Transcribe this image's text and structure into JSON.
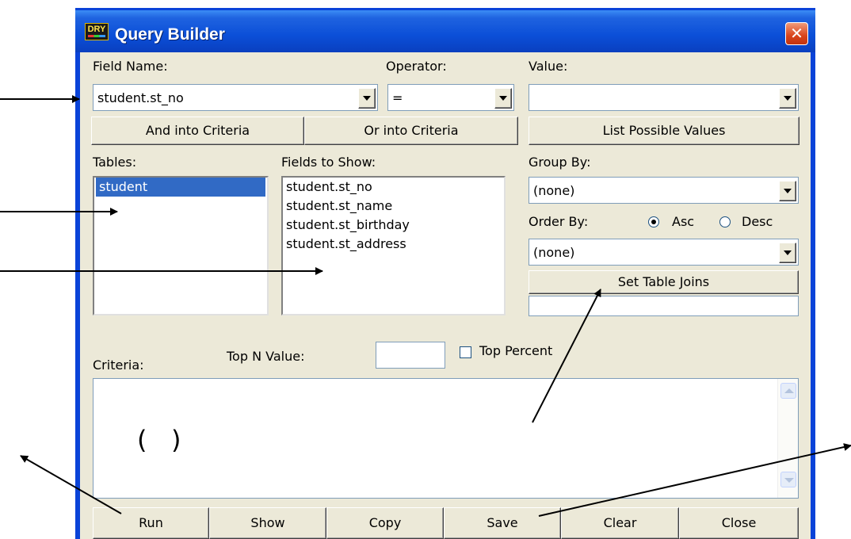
{
  "window": {
    "title": "Query Builder",
    "app_icon_text": "DRY"
  },
  "labels": {
    "field_name": "Field Name:",
    "operator": "Operator:",
    "value": "Value:",
    "tables": "Tables:",
    "fields_to_show": "Fields to Show:",
    "group_by": "Group By:",
    "order_by": "Order By:",
    "asc": "Asc",
    "desc": "Desc",
    "top_n_value": "Top N Value:",
    "top_percent": "Top Percent",
    "criteria": "Criteria:"
  },
  "inputs": {
    "field_name": "student.st_no",
    "operator": "=",
    "value": "",
    "group_by": "(none)",
    "order_by": "(none)",
    "top_n_value": "",
    "join_info": "",
    "criteria_text": "(   )"
  },
  "buttons": {
    "and_into_criteria": "And into Criteria",
    "or_into_criteria": "Or into Criteria",
    "list_possible_values": "List Possible Values",
    "set_table_joins": "Set Table Joins",
    "run": "Run",
    "show": "Show",
    "copy": "Copy",
    "save": "Save",
    "clear": "Clear",
    "close": "Close"
  },
  "tables": [
    "student"
  ],
  "fields_to_show": [
    "student.st_no",
    "student.st_name",
    "student.st_birthday",
    "student.st_address"
  ],
  "order_direction": "Asc",
  "top_percent_checked": false,
  "colors": {
    "titlebar": "#0a4fd8",
    "selection": "#316ac5",
    "dialog_bg": "#ece9d8",
    "close_button": "#d9441b"
  }
}
